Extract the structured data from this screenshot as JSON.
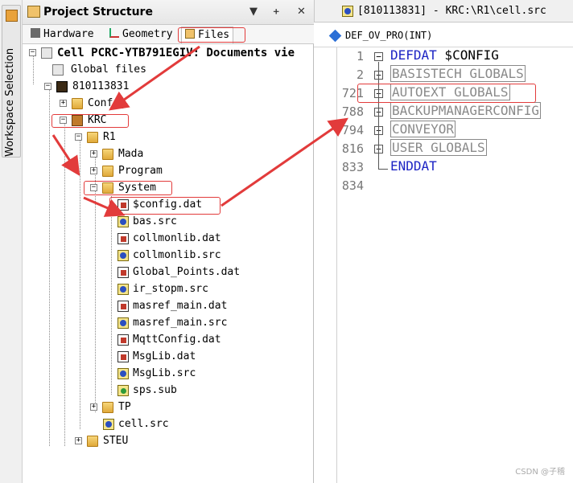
{
  "workspace": {
    "label": "Workspace Selection"
  },
  "project_panel": {
    "title": "Project Structure",
    "controls": [
      "▼",
      "ᚐ",
      "✕"
    ],
    "tabs": [
      {
        "label": "Hardware",
        "icon": "hardware-icon"
      },
      {
        "label": "Geometry",
        "icon": "geometry-icon"
      },
      {
        "label": "Files",
        "icon": "files-icon"
      }
    ]
  },
  "tree": {
    "cell": "Cell PCRC-YTB791EGIV: Documents vie",
    "global_files": "Global files",
    "controller": "810113831",
    "config": "Config",
    "krc": "KRC",
    "r1": "R1",
    "mada": "Mada",
    "program": "Program",
    "system": "System",
    "files": [
      {
        "label": "$config.dat",
        "type": "dat"
      },
      {
        "label": "bas.src",
        "type": "src"
      },
      {
        "label": "collmonlib.dat",
        "type": "dat"
      },
      {
        "label": "collmonlib.src",
        "type": "src"
      },
      {
        "label": "Global_Points.dat",
        "type": "dat"
      },
      {
        "label": "ir_stopm.src",
        "type": "src"
      },
      {
        "label": "masref_main.dat",
        "type": "dat"
      },
      {
        "label": "masref_main.src",
        "type": "src"
      },
      {
        "label": "MqttConfig.dat",
        "type": "dat"
      },
      {
        "label": "MsgLib.dat",
        "type": "dat"
      },
      {
        "label": "MsgLib.src",
        "type": "src"
      },
      {
        "label": "sps.sub",
        "type": "sub"
      }
    ],
    "tp": "TP",
    "cell_src": "cell.src",
    "steu": "STEU"
  },
  "editor": {
    "title": "[810113831] - KRC:\\R1\\cell.src",
    "function": "DEF_OV_PRO(INT)",
    "lines": [
      {
        "num": "1",
        "keyword": "DEFDAT",
        "text": " $CONFIG"
      },
      {
        "num": "2",
        "folded": "BASISTECH GLOBALS"
      },
      {
        "num": "721",
        "folded": "AUTOEXT GLOBALS"
      },
      {
        "num": "788",
        "folded": "BACKUPMANAGERCONFIG"
      },
      {
        "num": "794",
        "folded": "CONVEYOR"
      },
      {
        "num": "816",
        "folded": "USER GLOBALS"
      },
      {
        "num": "833",
        "keyword": "ENDDAT",
        "text": ""
      },
      {
        "num": "834",
        "text": ""
      }
    ]
  },
  "watermark": "CSDN @子稽",
  "colors": {
    "highlight": "#e23b3b",
    "keyword": "#1d24c4"
  }
}
